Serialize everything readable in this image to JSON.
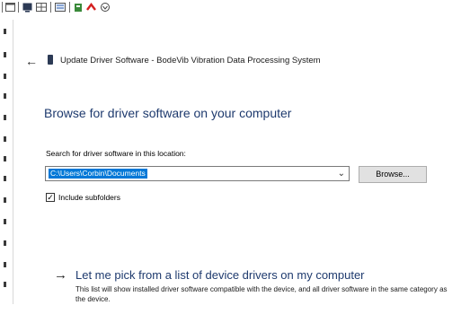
{
  "background": {
    "toolbar_icons": [
      "window-icon",
      "monitor-icon",
      "grid-icon",
      "list-icon",
      "properties-icon",
      "uninstall-icon",
      "scan-icon"
    ]
  },
  "dialog": {
    "back_icon": "←",
    "title": "Update Driver Software - BodeVib Vibration Data Processing System",
    "heading": "Browse for driver software on your computer",
    "search_label": "Search for driver software in this location:",
    "path_value": "C:\\Users\\Corbin\\Documents",
    "combo_chevron": "⌄",
    "browse_label": "Browse...",
    "include_subfolders": {
      "checked": true,
      "check_glyph": "✓",
      "label": "Include subfolders"
    },
    "pick_option": {
      "arrow": "→",
      "title": "Let me pick from a list of device drivers on my computer",
      "description": "This list will show installed driver software compatible with the device, and all driver software in the same category as the device."
    }
  },
  "colors": {
    "heading_blue": "#1e3a6e",
    "selection_blue": "#0078d7",
    "button_gray": "#e1e1e1"
  }
}
